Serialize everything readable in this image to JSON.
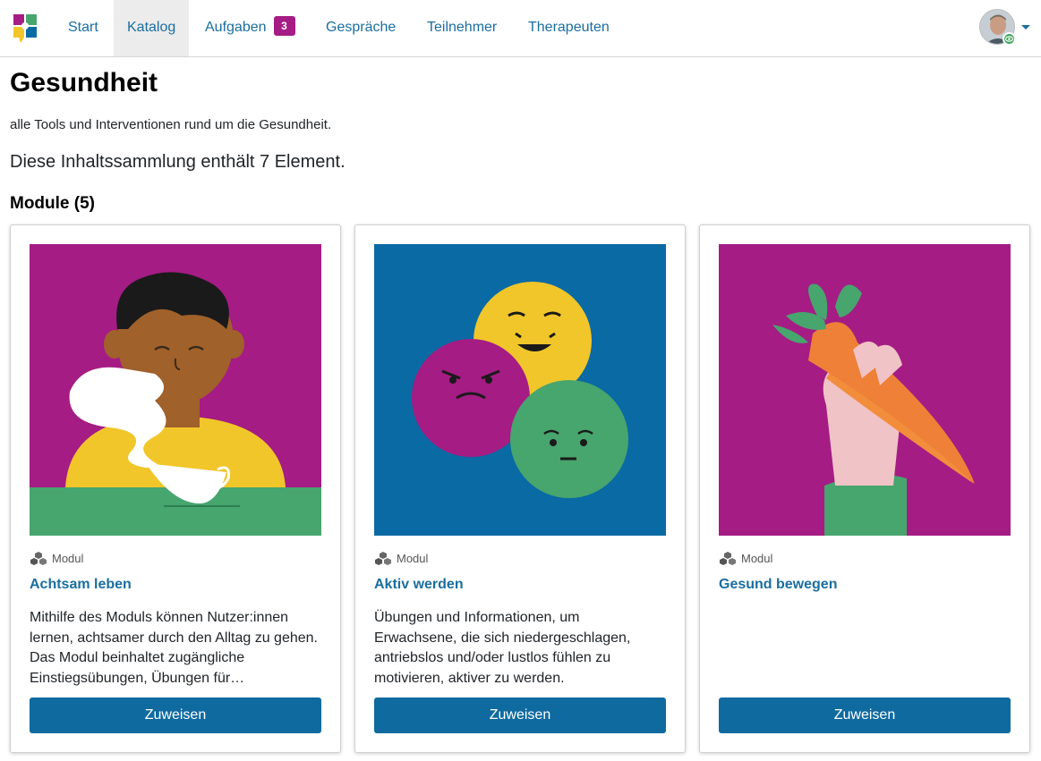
{
  "nav": {
    "items": [
      {
        "label": "Start"
      },
      {
        "label": "Katalog"
      },
      {
        "label": "Aufgaben",
        "badge": "3"
      },
      {
        "label": "Gespräche"
      },
      {
        "label": "Teilnehmer"
      },
      {
        "label": "Therapeuten"
      }
    ],
    "active": "Katalog",
    "icons": {
      "logo": "app-logo",
      "avatar": "user-avatar",
      "status": "eye-status-icon",
      "menu": "caret-down-icon"
    }
  },
  "page": {
    "title": "Gesundheit",
    "description": "alle Tools und Interventionen rund um die Gesundheit.",
    "count_text": "Diese Inhaltssammlung enthält 7 Element.",
    "section_title": "Module (5)"
  },
  "cards": [
    {
      "type": "Modul",
      "title": "Achtsam leben",
      "text": "Mithilfe des Moduls können Nutzer:innen lernen, achtsamer durch den Alltag zu gehen. Das Modul beinhaltet zugängliche Einstiegsübungen, Übungen für…",
      "button": "Zuweisen",
      "image": "person-with-tea-illustration"
    },
    {
      "type": "Modul",
      "title": "Aktiv werden",
      "text": "Übungen und Informationen, um Erwachsene, die sich niedergeschlagen, antriebslos und/oder lustlos fühlen zu motivieren, aktiver zu werden.",
      "button": "Zuweisen",
      "image": "emotion-faces-illustration"
    },
    {
      "type": "Modul",
      "title": "Gesund bewegen",
      "text": "",
      "button": "Zuweisen",
      "image": "hand-holding-carrots-illustration"
    }
  ],
  "colors": {
    "link": "#1a6ea0",
    "button": "#0f6aa0",
    "badge": "#a51c84",
    "magenta": "#a51c84",
    "blue": "#0a6aa4",
    "green": "#47a56e",
    "yellow": "#f1c62a"
  }
}
